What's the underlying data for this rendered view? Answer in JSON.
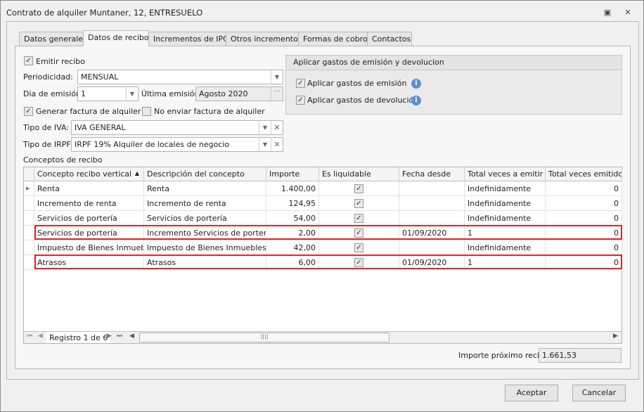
{
  "window": {
    "title": "Contrato de alquiler Muntaner, 12, ENTRESUELO"
  },
  "tabs": [
    "Datos generales",
    "Datos de recibo",
    "Incrementos de IPC",
    "Otros incrementos",
    "Formas de cobro",
    "Contactos"
  ],
  "form": {
    "emitir_recibo": "Emitir recibo",
    "periodicidad_label": "Periodicidad:",
    "periodicidad": "MENSUAL",
    "dia_label": "Dia de emisión:",
    "dia": "1",
    "ultima_label": "Última emisión:",
    "ultima": "Agosto 2020",
    "generar_factura": "Generar factura de alquiler",
    "no_enviar": "No enviar factura de alquiler",
    "iva_label": "Tipo de IVA:",
    "iva": "IVA GENERAL",
    "irpf_label": "Tipo de IRPF:",
    "irpf": "IRPF 19% Alquiler de locales de negocio",
    "conceptos_label": "Conceptos de recibo"
  },
  "gastos": {
    "title": "Aplicar gastos de emisión y devolucion",
    "emision": "Aplicar gastos de emisión",
    "devolucion": "Aplicar gastos de devolución"
  },
  "grid": {
    "columns": [
      "Concepto recibo vertical",
      "Descripción del concepto",
      "Importe",
      "Es liquidable",
      "Fecha desde",
      "Total veces a emitir",
      "Total veces emitido"
    ],
    "rows": [
      [
        "Renta",
        "Renta",
        "1.400,00",
        "",
        "Indefinidamente",
        "0"
      ],
      [
        "Incremento de renta",
        "Incremento de renta",
        "124,95",
        "",
        "Indefinidamente",
        "0"
      ],
      [
        "Servicios de portería",
        "Servicios de portería",
        "54,00",
        "",
        "Indefinidamente",
        "0"
      ],
      [
        "Servicios de portería",
        "Incremento Servicios de portería",
        "2,00",
        "01/09/2020",
        "1",
        "0"
      ],
      [
        "Impuesto de Bienes Inmuebles",
        "Impuesto de Bienes Inmuebles",
        "42,00",
        "",
        "Indefinidamente",
        "0"
      ],
      [
        "Atrasos",
        "Atrasos",
        "6,00",
        "01/09/2020",
        "1",
        "0"
      ]
    ],
    "nav_text": "Registro 1 de 6"
  },
  "importe_label": "Importe próximo recibo",
  "importe": "1.661,53",
  "buttons": {
    "ok": "Aceptar",
    "cancel": "Cancelar"
  },
  "colors": {
    "highlight": "#e0262d"
  }
}
